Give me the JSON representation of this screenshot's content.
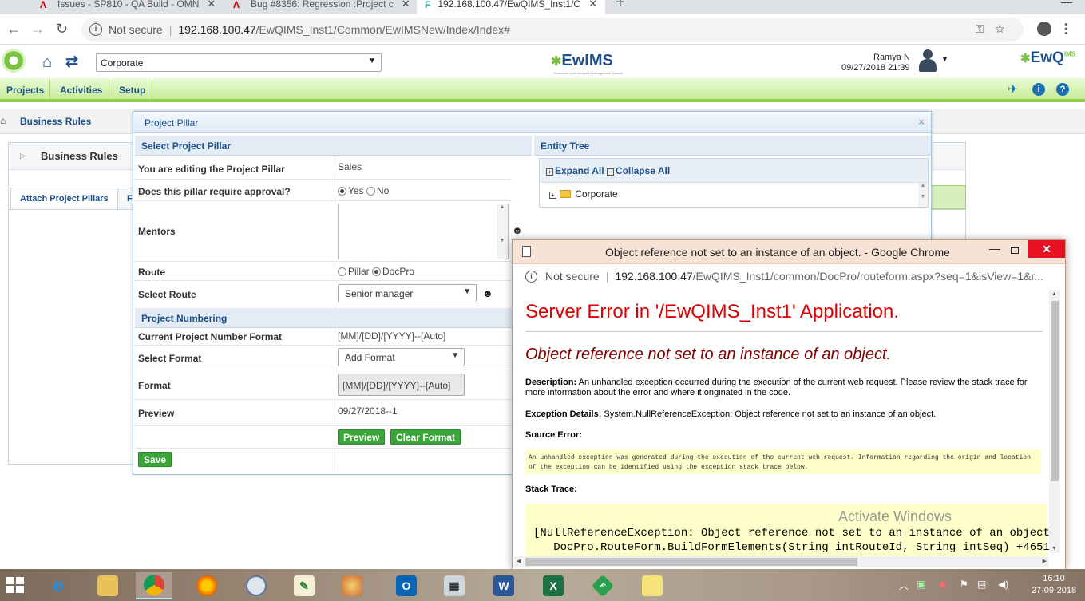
{
  "browser": {
    "tabs": [
      {
        "title": "Issues - SP810 - QA Build - OMN",
        "active": false
      },
      {
        "title": "Bug #8356: Regression :Project c",
        "active": false
      },
      {
        "title": "192.168.100.47/EwQIMS_Inst1/C",
        "active": true
      }
    ],
    "new_tab": "+",
    "not_secure": "Not secure",
    "url_host": "192.168.100.47",
    "url_path": "/EwQIMS_Inst1/Common/EwIMSNew/Index/Index#"
  },
  "header": {
    "org_select": "Corporate",
    "center_logo": "EwIMS",
    "center_tagline": "Enterprise-wide Integrated Management System",
    "user_name": "Ramya N",
    "user_datetime": "09/27/2018 21:39",
    "right_logo": "EwQ",
    "right_logo_sup": "IMS",
    "right_logo_sub": "MS"
  },
  "menu": {
    "items": [
      "Projects",
      "Activities",
      "Setup"
    ]
  },
  "page": {
    "breadcrumb": "Business Rules",
    "panel_title": "Business Rules",
    "tabs": [
      "Attach Project Pillars",
      "F"
    ]
  },
  "modal": {
    "title": "Project Pillar",
    "close": "×",
    "select_section": "Select Project Pillar",
    "rows": {
      "editing_label": "You are editing the Project Pillar",
      "editing_value": "Sales",
      "approval_label": "Does this pillar require approval?",
      "approval_yes": "Yes",
      "approval_no": "No",
      "mentors_label": "Mentors",
      "route_label": "Route",
      "route_pillar": "Pillar",
      "route_docpro": "DocPro",
      "select_route_label": "Select Route",
      "select_route_value": "Senior manager"
    },
    "numbering_section": "Project Numbering",
    "numbering": {
      "current_label": "Current Project Number Format",
      "current_value": "[MM]/[DD]/[YYYY]--[Auto]",
      "select_format_label": "Select Format",
      "select_format_value": "Add Format",
      "format_label": "Format",
      "format_value": "[MM]/[DD]/[YYYY]--[Auto]",
      "preview_label": "Preview",
      "preview_value": "09/27/2018--1",
      "preview_button": "Preview",
      "clear_button": "Clear Format",
      "save_button": "Save"
    },
    "entity_tree": {
      "title": "Entity Tree",
      "expand_all": "Expand All",
      "collapse_all": "Collapse All",
      "node": "Corporate"
    }
  },
  "popup": {
    "title": "Object reference not set to an instance of an object. - Google Chrome",
    "not_secure": "Not secure",
    "url_host": "192.168.100.47",
    "url_path": "/EwQIMS_Inst1/common/DocPro/routeform.aspx?seq=1&isView=1&r...",
    "heading": "Server Error in '/EwQIMS_Inst1' Application.",
    "subheading": "Object reference not set to an instance of an object.",
    "description_label": "Description:",
    "description_text": "An unhandled exception occurred during the execution of the current web request. Please review the stack trace for more information about the error and where it originated in the code.",
    "exception_label": "Exception Details:",
    "exception_text": "System.NullReferenceException: Object reference not set to an instance of an object.",
    "source_error_label": "Source Error:",
    "source_error_text": "An unhandled exception was generated during the execution of the current web request. Information regarding the origin and location of the exception can be identified using the exception stack trace below.",
    "stack_trace_label": "Stack Trace:",
    "stack_line_1": "[NullReferenceException: Object reference not set to an instance of an object.]",
    "stack_line_2": "   DocPro.RouteForm.BuildFormElements(String intRouteId, String intSeq) +4651",
    "watermark": "Activate Windows"
  },
  "taskbar": {
    "time": "16:10",
    "date": "27-09-2018"
  }
}
